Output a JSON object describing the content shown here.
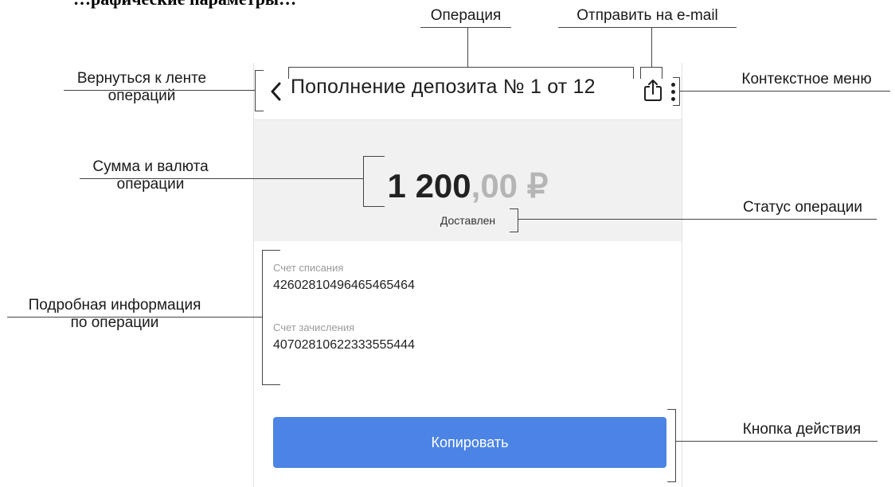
{
  "heading_fragment": "…рафические параметры…",
  "screen": {
    "title": "Пополнение депозита № 1 от 12",
    "amount_main": "1 200",
    "amount_decimals": ",00 ₽",
    "status": "Доставлен",
    "fields": [
      {
        "label": "Счет списания",
        "value": "42602810496465465464"
      },
      {
        "label": "Счет зачисления",
        "value": "40702810622333555444"
      }
    ],
    "action_button": "Копировать"
  },
  "annotations": {
    "operation": "Операция",
    "send_email": "Отправить на e-mail",
    "back_line1": "Вернуться к ленте",
    "back_line2": "операций",
    "context_menu": "Контекстное меню",
    "amount_line1": "Сумма и валюта",
    "amount_line2": "операции",
    "status": "Статус операции",
    "details_line1": "Подробная информация",
    "details_line2": "по операции",
    "action_button": "Кнопка действия"
  },
  "icons": {
    "back": "chevron-left-icon",
    "share": "share-icon",
    "menu": "more-vertical-icon"
  },
  "colors": {
    "accent_button": "#4b84e4",
    "amount_background": "#f1f1f1",
    "decimals_gray": "#b5b5b5"
  }
}
